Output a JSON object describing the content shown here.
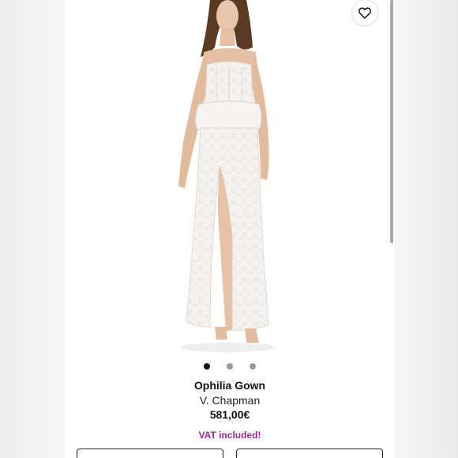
{
  "product": {
    "name": "Ophilia Gown",
    "brand": "V. Chapman",
    "price": "581,00€",
    "vat_note": "VAT included!"
  },
  "gallery": {
    "image_count": 3,
    "active_index": 0
  },
  "icons": {
    "wishlist": "heart-icon"
  },
  "colors": {
    "vat_text": "#a0279a",
    "active_dot": "#111111",
    "inactive_dot": "#9a9a9a"
  }
}
